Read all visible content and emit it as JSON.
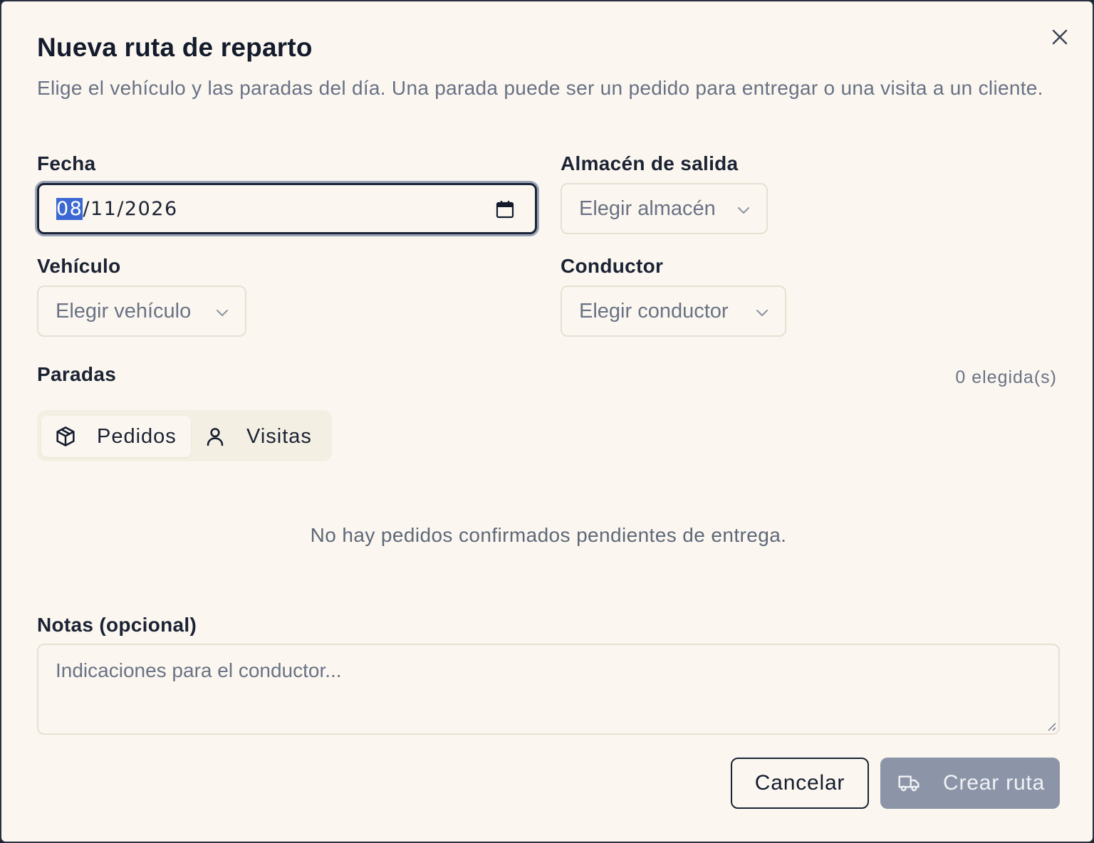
{
  "dialog": {
    "title": "Nueva ruta de reparto",
    "subtitle": "Elige el vehículo y las paradas del día. Una parada puede ser un pedido para entregar o una visita a un cliente."
  },
  "fields": {
    "date": {
      "label": "Fecha",
      "day": "08",
      "rest": "/11/2026"
    },
    "warehouse": {
      "label": "Almacén de salida",
      "placeholder": "Elegir almacén"
    },
    "vehicle": {
      "label": "Vehículo",
      "placeholder": "Elegir vehículo"
    },
    "driver": {
      "label": "Conductor",
      "placeholder": "Elegir conductor"
    }
  },
  "stops": {
    "label": "Paradas",
    "count": "0 elegida(s)",
    "tabs": [
      {
        "label": "Pedidos",
        "icon": "package-icon",
        "active": true
      },
      {
        "label": "Visitas",
        "icon": "user-icon",
        "active": false
      }
    ],
    "empty_message": "No hay pedidos confirmados pendientes de entrega."
  },
  "notes": {
    "label": "Notas (opcional)",
    "placeholder": "Indicaciones para el conductor..."
  },
  "actions": {
    "cancel": "Cancelar",
    "create": "Crear ruta",
    "create_icon": "truck-icon"
  },
  "colors": {
    "background": "#fbf7f0",
    "selection": "#3b68d4",
    "create_disabled": "#8c95a8"
  }
}
